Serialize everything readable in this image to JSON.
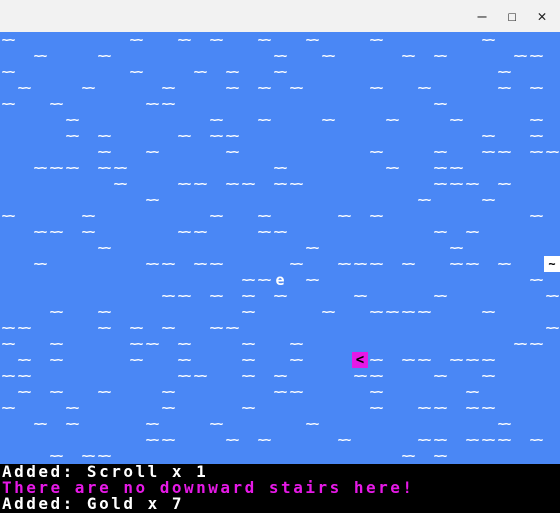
{
  "window": {
    "minimize": "—",
    "maximize": "☐",
    "close": "✕"
  },
  "map": {
    "water_glyph": "~~",
    "player_glyph": "<",
    "item_glyph": "e",
    "item2_glyph": "~",
    "colors": {
      "water": "#4a87f5",
      "player": "#e619e6"
    }
  },
  "log": {
    "line1": "Added: Scroll x 1",
    "line2": "There are no downward stairs here!",
    "line3": "Added: Gold x 7"
  }
}
